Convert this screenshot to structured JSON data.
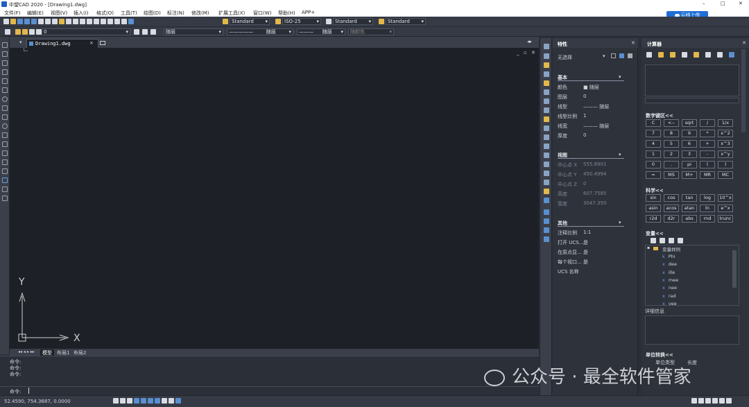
{
  "window": {
    "title": "中望CAD 2020 - [Drawing1.dwg]",
    "min": "–",
    "max": "□",
    "close": "✕"
  },
  "menu": [
    "文件(F)",
    "编辑(E)",
    "视图(V)",
    "插入(I)",
    "格式(O)",
    "工具(T)",
    "绘图(D)",
    "标注(N)",
    "修改(M)",
    "扩展工具(X)",
    "窗口(W)",
    "帮助(H)",
    "APP+"
  ],
  "cloud_button": "云线上传",
  "toolbar1": {
    "text_style": "Standard",
    "dim_style": "ISO-25",
    "table_style": "Standard",
    "ml_style": "Standard"
  },
  "toolbar2": {
    "layer": "0",
    "color": "随层",
    "linetype": "随层",
    "lineweight": "随层",
    "plotstyle": "随颜色"
  },
  "doc_tab": {
    "name": "Drawing1.dwg",
    "close": "×"
  },
  "layout_tabs": [
    "模型",
    "布局1",
    "布局2"
  ],
  "axes": {
    "y": "Y",
    "x": "X"
  },
  "command": {
    "history": [
      "命令:",
      "命令:",
      "命令:"
    ],
    "prompt": "命令:"
  },
  "status": {
    "coords": "52.4590, 754.3687, 0.0000"
  },
  "properties": {
    "title": "特性",
    "selection": "无选择",
    "basic": {
      "header": "基本",
      "rows": [
        {
          "k": "颜色",
          "v": "■ 随层"
        },
        {
          "k": "图层",
          "v": "0"
        },
        {
          "k": "线型",
          "v": "——— 随层"
        },
        {
          "k": "线型比例",
          "v": "1"
        },
        {
          "k": "线宽",
          "v": "——— 随层"
        },
        {
          "k": "厚度",
          "v": "0"
        }
      ]
    },
    "view": {
      "header": "视图",
      "rows": [
        {
          "k": "中心点 X",
          "v": "555.8901"
        },
        {
          "k": "中心点 Y",
          "v": "450.4994"
        },
        {
          "k": "中心点 Z",
          "v": "0"
        },
        {
          "k": "高度",
          "v": "607.7585"
        },
        {
          "k": "宽度",
          "v": "3047.350"
        }
      ]
    },
    "misc": {
      "header": "其他",
      "rows": [
        {
          "k": "注释比例",
          "v": "1:1"
        },
        {
          "k": "打开 UCS...",
          "v": "是"
        },
        {
          "k": "在原点显...",
          "v": "是"
        },
        {
          "k": "每个视口...",
          "v": "是"
        },
        {
          "k": "UCS 名称",
          "v": ""
        }
      ]
    }
  },
  "calculator": {
    "title": "计算器",
    "numpad_header": "数字键区<<",
    "numpad": [
      [
        "C",
        "<--",
        "sqrt",
        "/",
        "1/x"
      ],
      [
        "7",
        "8",
        "9",
        "*",
        "x^2"
      ],
      [
        "4",
        "5",
        "6",
        "+",
        "x^3"
      ],
      [
        "1",
        "2",
        "3",
        "-",
        "x^y"
      ],
      [
        "0",
        ".",
        "pi",
        "(",
        ")"
      ],
      [
        "=",
        "MS",
        "M+",
        "MR",
        "MC"
      ]
    ],
    "sci_header": "科学<<",
    "sci": [
      [
        "sin",
        "cos",
        "tan",
        "log",
        "10^x"
      ],
      [
        "asin",
        "acos",
        "atan",
        "ln",
        "e^x"
      ],
      [
        "r2d",
        "d2r",
        "abs",
        "rnd",
        "trunc"
      ]
    ],
    "var_header": "变量<<",
    "var_group": "变量样例",
    "vars": [
      "Phi",
      "dee",
      "ille",
      "mee",
      "nee",
      "rad",
      "vee"
    ],
    "detail_label": "详细信息",
    "unit_header": "单位转换<<",
    "unit_type_label": "单位类型",
    "unit_type_value": "长度"
  },
  "watermark": "公众号 · 最全软件管家"
}
